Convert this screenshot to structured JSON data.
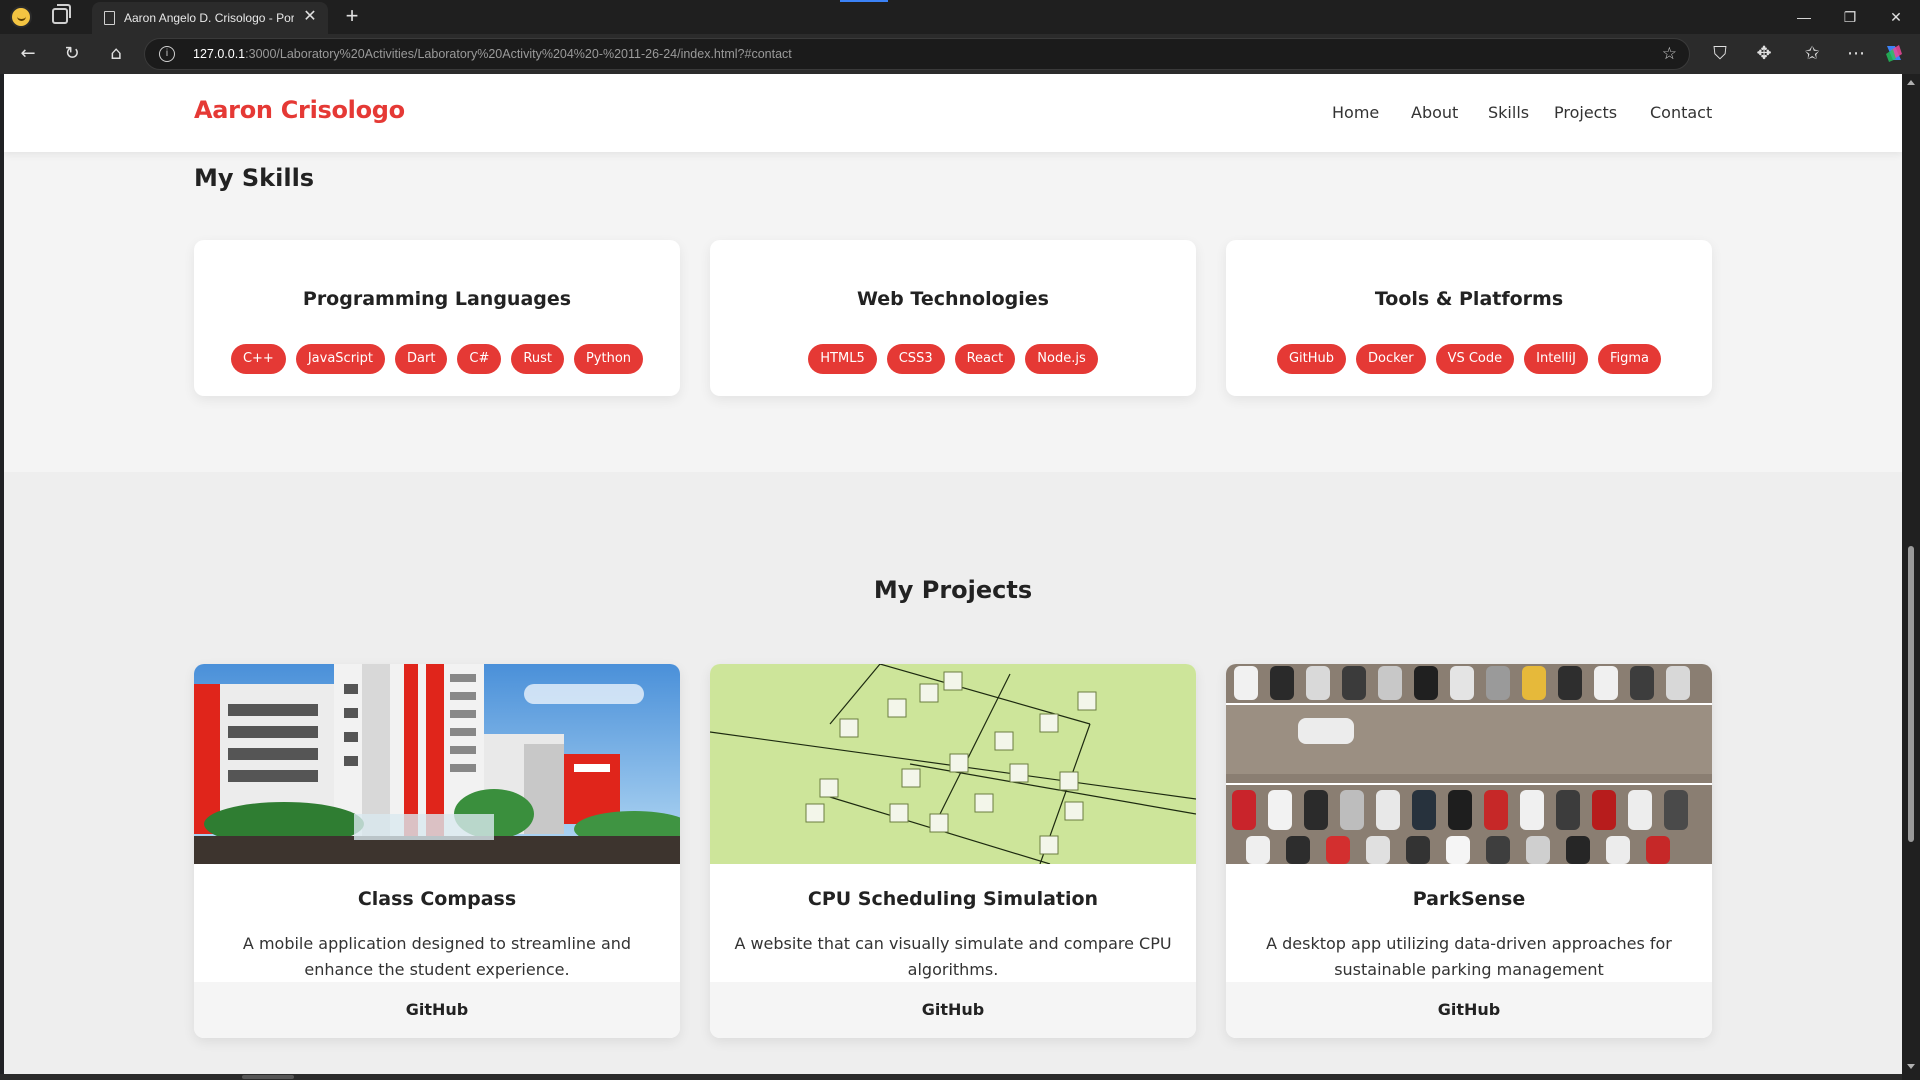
{
  "browser": {
    "tab_title": "Aaron Angelo D. Crisologo - Portfolio",
    "url_host": "127.0.0.1",
    "url_path": ":3000/Laboratory%20Activities/Laboratory%20Activity%204%20-%2011-26-24/index.html?#contact",
    "close_glyph": "✕",
    "new_tab_glyph": "+",
    "controls": {
      "minimize": "—",
      "restore": "❐",
      "close": "✕"
    }
  },
  "site": {
    "brand": "Aaron Crisologo",
    "nav": [
      "Home",
      "About",
      "Skills",
      "Projects",
      "Contact"
    ]
  },
  "skills": {
    "title": "My Skills",
    "categories": [
      {
        "title": "Programming Languages",
        "items": [
          "C++",
          "JavaScript",
          "Dart",
          "C#",
          "Rust",
          "Python"
        ]
      },
      {
        "title": "Web Technologies",
        "items": [
          "HTML5",
          "CSS3",
          "React",
          "Node.js"
        ]
      },
      {
        "title": "Tools & Platforms",
        "items": [
          "GitHub",
          "Docker",
          "VS Code",
          "IntelliJ",
          "Figma"
        ]
      }
    ]
  },
  "projects": {
    "title": "My Projects",
    "items": [
      {
        "title": "Class Compass",
        "description": "A mobile application designed to streamline and enhance the student experience.",
        "link": "GitHub"
      },
      {
        "title": "CPU Scheduling Simulation",
        "description": "A website that can visually simulate and compare CPU algorithms.",
        "link": "GitHub"
      },
      {
        "title": "ParkSense",
        "description": "A desktop app utilizing data-driven approaches for sustainable parking management",
        "link": "GitHub"
      }
    ]
  },
  "colors": {
    "accent": "#e53935",
    "page_bg": "#f4f4f4",
    "chrome_bg": "#2b2b2b"
  },
  "icons": [
    "profile-avatar-icon",
    "collections-icon",
    "page-icon",
    "back-arrow-icon",
    "refresh-icon",
    "home-icon",
    "info-icon",
    "favorite-star-icon",
    "shield-icon",
    "extensions-icon",
    "favorites-icon",
    "more-icon",
    "copilot-icon"
  ]
}
